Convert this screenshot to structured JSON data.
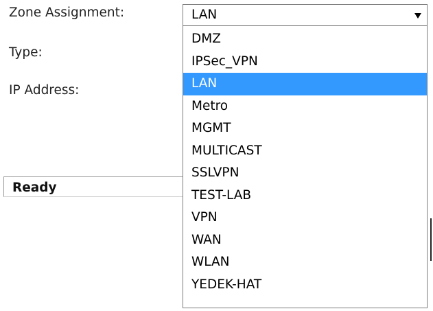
{
  "form": {
    "zone_label": "Zone Assignment:",
    "type_label": "Type:",
    "ip_label": "IP Address:"
  },
  "status": {
    "text": "Ready"
  },
  "zone_select": {
    "value": "LAN",
    "selected_index": 2,
    "options": [
      "DMZ",
      "IPSec_VPN",
      "LAN",
      "Metro",
      "MGMT",
      "MULTICAST",
      "SSLVPN",
      "TEST-LAB",
      "VPN",
      "WAN",
      "WLAN",
      "YEDEK-HAT"
    ]
  },
  "colors": {
    "selection_bg": "#3399ff",
    "selection_text": "#ffffff"
  }
}
